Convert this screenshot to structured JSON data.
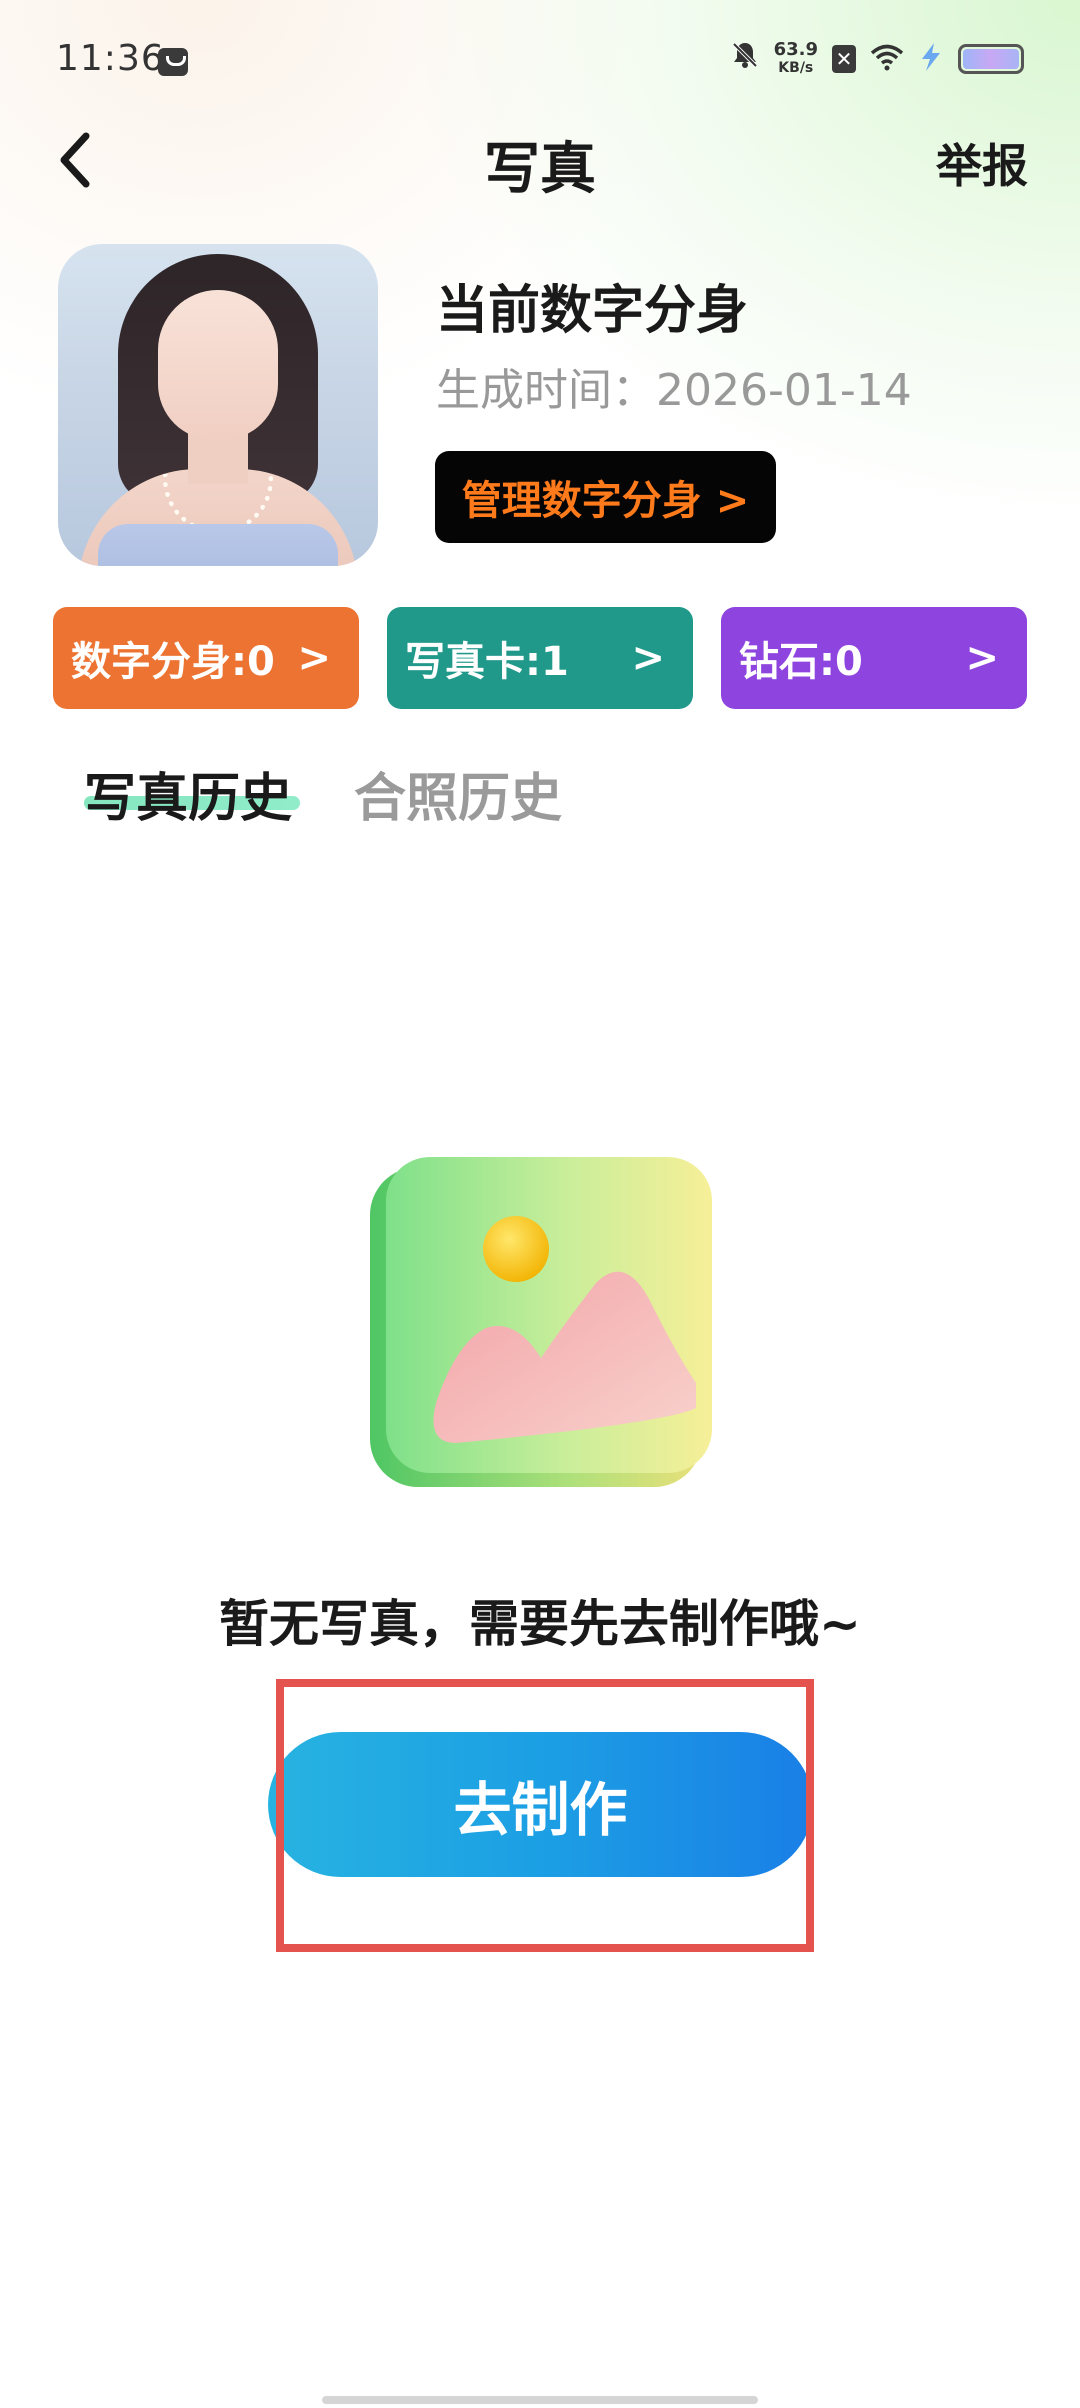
{
  "status_bar": {
    "time": "11:36",
    "net_speed_value": "63.9",
    "net_speed_unit": "KB/s"
  },
  "header": {
    "title": "写真",
    "report_label": "举报"
  },
  "profile": {
    "twin_title": "当前数字分身",
    "gen_time": "生成时间：2026-01-14",
    "manage_button": "管理数字分身 >"
  },
  "stats": [
    {
      "label": "数字分身:0",
      "arrow": ">",
      "color": "#ec7331"
    },
    {
      "label": "写真卡:1",
      "arrow": ">",
      "color": "#21998a"
    },
    {
      "label": "钻石:0",
      "arrow": ">",
      "color": "#8e44de"
    }
  ],
  "tabs": [
    {
      "label": "写真历史",
      "active": true
    },
    {
      "label": "合照历史",
      "active": false
    }
  ],
  "empty_state": {
    "message": "暂无写真，需要先去制作哦~",
    "button_label": "去制作"
  },
  "colors": {
    "highlight_border": "#e5534f",
    "manage_text": "#ff7a1a"
  }
}
